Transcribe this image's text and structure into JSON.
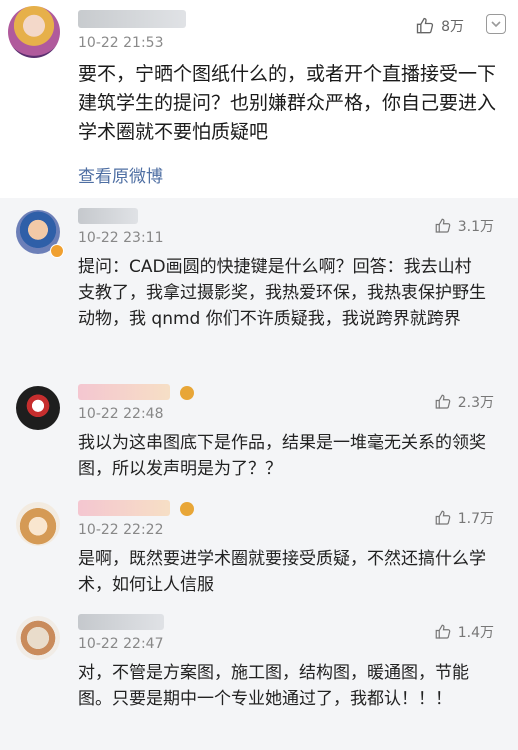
{
  "featured": {
    "username": "",
    "time": "10-22 21:53",
    "likes": "8万",
    "text": "要不，宁晒个图纸什么的，或者开个直播接受一下建筑学生的提问？也别嫌群众严格，你自己要进入学术圈就不要怕质疑吧",
    "view_original": "查看原微博",
    "icons": {
      "like": "thumb-up-icon",
      "menu": "dropdown-icon"
    }
  },
  "replies": [
    {
      "time": "10-22 23:11",
      "likes": "3.1万",
      "text": "提问：CAD画圆的快捷键是什么啊？回答：我去山村支教了，我拿过摄影奖，我热爱环保，我热衷保护野生动物，我 qnmd 你们不许质疑我，我说跨界就跨界",
      "accent": "#3a6bb0"
    },
    {
      "time": "10-22 22:48",
      "likes": "2.3万",
      "text": "我以为这串图底下是作品，结果是一堆毫无关系的领奖图，所以发声明是为了？？",
      "accent": "#202020"
    },
    {
      "time": "10-22 22:22",
      "likes": "1.7万",
      "text": "是啊，既然要进学术圈就要接受质疑，不然还搞什么学术，如何让人信服",
      "accent": "#d8b07a"
    },
    {
      "time": "10-22 22:47",
      "likes": "1.4万",
      "text": "对，不管是方案图，施工图，结构图，暖通图，节能图。只要是期中一个专业她通过了，我都认！！！",
      "accent": "#e6d9c8"
    }
  ]
}
